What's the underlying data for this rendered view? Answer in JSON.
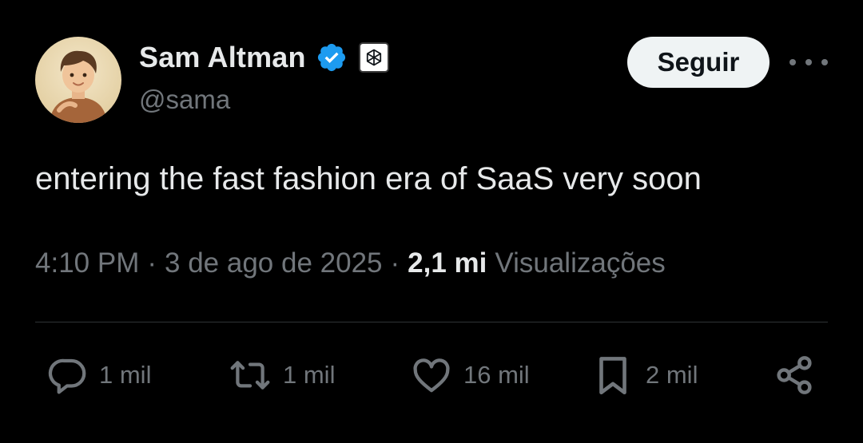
{
  "author": {
    "display_name": "Sam Altman",
    "handle": "@sama",
    "verified": true,
    "affiliation_icon": "openai-logo-icon",
    "verified_color": "#1d9bf0"
  },
  "follow_button": {
    "label": "Seguir"
  },
  "tweet": {
    "text": "entering the fast fashion era of SaaS very soon",
    "time": "4:10 PM",
    "separator": "·",
    "date": "3 de ago de 2025",
    "views_count": "2,1 mi",
    "views_label": "Visualizações"
  },
  "actions": {
    "replies": {
      "icon": "reply-icon",
      "count": "1 mil"
    },
    "reposts": {
      "icon": "repost-icon",
      "count": "1 mil"
    },
    "likes": {
      "icon": "heart-icon",
      "count": "16 mil"
    },
    "bookmarks": {
      "icon": "bookmark-icon",
      "count": "2 mil"
    },
    "share": {
      "icon": "share-icon"
    }
  },
  "colors": {
    "background": "#000000",
    "text_primary": "#e7e9ea",
    "text_secondary": "#71767b",
    "divider": "#2f3336",
    "button_bg": "#eff3f4"
  }
}
